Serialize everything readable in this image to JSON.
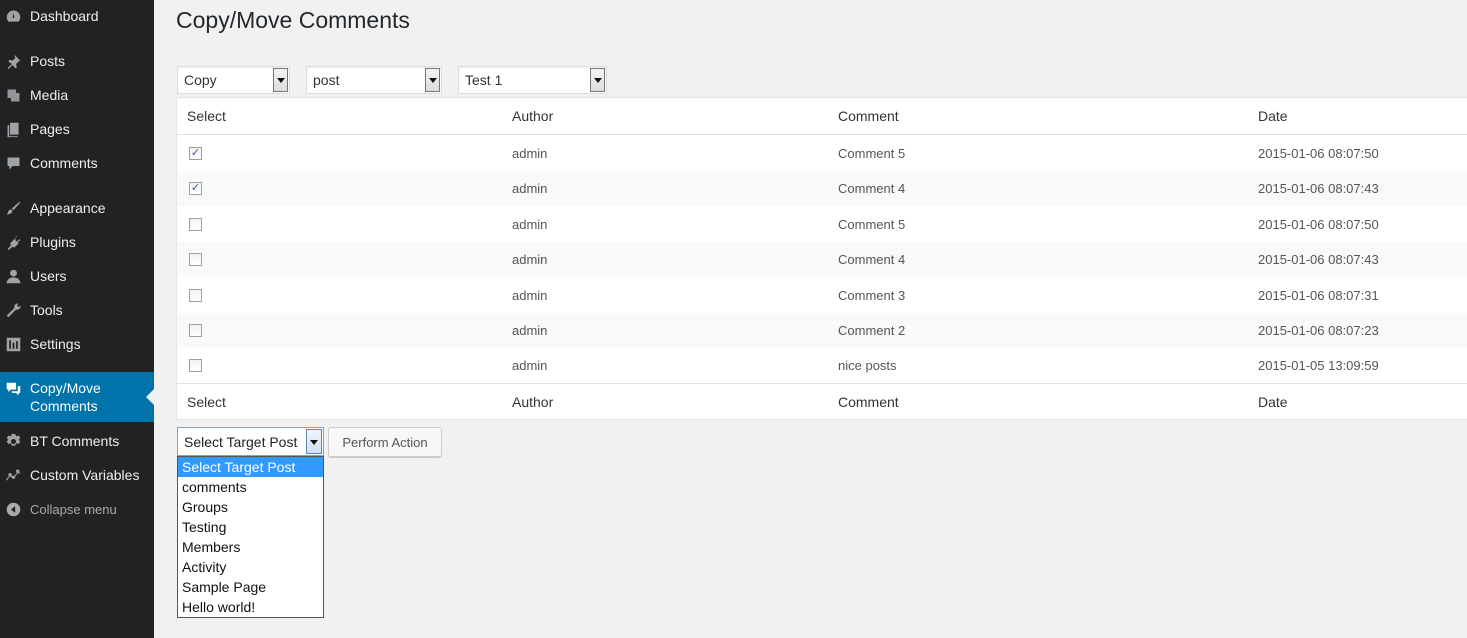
{
  "sidebar": {
    "items": [
      {
        "name": "dashboard",
        "label": "Dashboard",
        "icon": "dashboard-icon"
      },
      {
        "name": "posts",
        "label": "Posts",
        "icon": "pin-icon"
      },
      {
        "name": "media",
        "label": "Media",
        "icon": "media-icon"
      },
      {
        "name": "pages",
        "label": "Pages",
        "icon": "pages-icon"
      },
      {
        "name": "comments",
        "label": "Comments",
        "icon": "comment-icon"
      },
      {
        "name": "appearance",
        "label": "Appearance",
        "icon": "brush-icon"
      },
      {
        "name": "plugins",
        "label": "Plugins",
        "icon": "plug-icon"
      },
      {
        "name": "users",
        "label": "Users",
        "icon": "user-icon"
      },
      {
        "name": "tools",
        "label": "Tools",
        "icon": "wrench-icon"
      },
      {
        "name": "settings",
        "label": "Settings",
        "icon": "sliders-icon"
      },
      {
        "name": "copy-move-comments",
        "label": "Copy/Move Comments",
        "icon": "comments-icon"
      },
      {
        "name": "bt-comments",
        "label": "BT Comments",
        "icon": "gear-icon"
      },
      {
        "name": "custom-variables",
        "label": "Custom Variables",
        "icon": "chart-line-icon"
      }
    ],
    "collapse_label": "Collapse menu"
  },
  "page": {
    "title": "Copy/Move Comments"
  },
  "filters": {
    "action": "Copy",
    "post_type": "post",
    "post": "Test 1"
  },
  "table": {
    "headers": {
      "select": "Select",
      "author": "Author",
      "comment": "Comment",
      "date": "Date"
    },
    "rows": [
      {
        "checked": true,
        "author": "admin",
        "comment": "Comment 5",
        "date": "2015-01-06 08:07:50"
      },
      {
        "checked": true,
        "author": "admin",
        "comment": "Comment 4",
        "date": "2015-01-06 08:07:43"
      },
      {
        "checked": false,
        "author": "admin",
        "comment": "Comment 5",
        "date": "2015-01-06 08:07:50"
      },
      {
        "checked": false,
        "author": "admin",
        "comment": "Comment 4",
        "date": "2015-01-06 08:07:43"
      },
      {
        "checked": false,
        "author": "admin",
        "comment": "Comment 3",
        "date": "2015-01-06 08:07:31"
      },
      {
        "checked": false,
        "author": "admin",
        "comment": "Comment 2",
        "date": "2015-01-06 08:07:23"
      },
      {
        "checked": false,
        "author": "admin",
        "comment": "nice posts",
        "date": "2015-01-05 13:09:59"
      }
    ]
  },
  "target": {
    "selected": "Select Target Post",
    "options": [
      "Select Target Post",
      "comments",
      "Groups",
      "Testing",
      "Members",
      "Activity",
      "Sample Page",
      "Hello world!"
    ]
  },
  "actions": {
    "perform_label": "Perform Action"
  },
  "colors": {
    "sidebar_bg": "#222222",
    "active_menu": "#0073aa",
    "dropdown_highlight": "#3399ff"
  }
}
